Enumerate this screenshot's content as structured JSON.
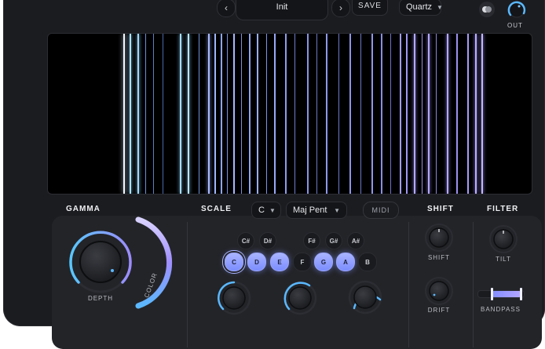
{
  "top_bar": {
    "preset_name": "Init",
    "prev_label": "‹",
    "next_label": "›",
    "save_label": "SAVE",
    "tuning": "Quartz",
    "out_label": "OUT"
  },
  "display": {
    "colors": {
      "cool": "#8fd3ff",
      "violet": "#9a8cff",
      "bg": "#000000"
    }
  },
  "gamma": {
    "title": "GAMMA",
    "depth_label": "DEPTH",
    "color_label": "COLOR"
  },
  "scale": {
    "title": "SCALE",
    "root": "C",
    "mode": "Maj Pent",
    "midi_label": "MIDI",
    "sharps": [
      "C#",
      "D#",
      "F#",
      "G#",
      "A#"
    ],
    "naturals": [
      "C",
      "D",
      "E",
      "F",
      "G",
      "A",
      "B"
    ],
    "active_notes": [
      "C",
      "D",
      "E",
      "G",
      "A"
    ]
  },
  "shift": {
    "title": "SHIFT",
    "shift_label": "SHIFT",
    "drift_label": "DRIFT"
  },
  "filter": {
    "title": "FILTER",
    "tilt_label": "TILT",
    "bandpass_label": "BANDPASS"
  },
  "accent": {
    "blue": "#5ab8ff",
    "violet": "#a79bff",
    "panel": "#232428"
  }
}
